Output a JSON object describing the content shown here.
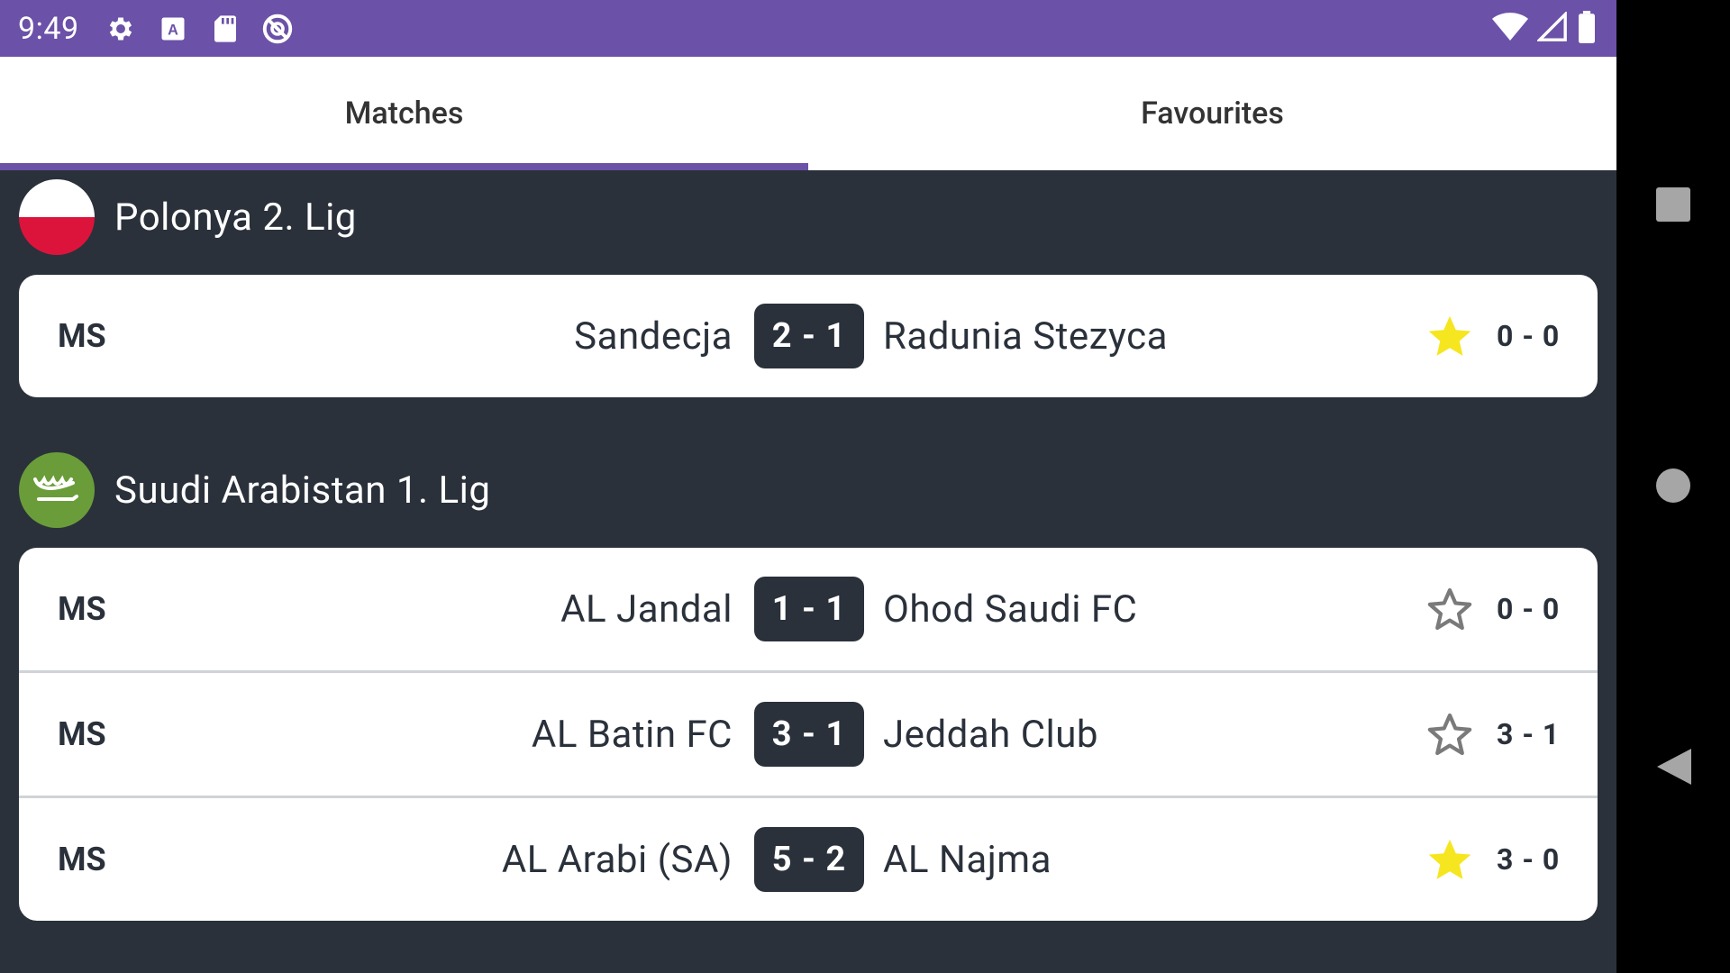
{
  "status_bar": {
    "time": "9:49",
    "icons": [
      "settings-icon",
      "font-a-icon",
      "sd-card-icon",
      "no-sync-icon"
    ],
    "right_icons": [
      "wifi-icon",
      "signal-icon",
      "battery-icon"
    ]
  },
  "tabs": [
    {
      "label": "Matches",
      "active": true
    },
    {
      "label": "Favourites",
      "active": false
    }
  ],
  "leagues": [
    {
      "name": "Polonya 2. Lig",
      "flag": "poland-flag",
      "matches": [
        {
          "status": "MS",
          "home": "Sandecja",
          "score": "2 - 1",
          "away": "Radunia Stezyca",
          "favourite": true,
          "half_time": "0 - 0"
        }
      ]
    },
    {
      "name": "Suudi Arabistan 1. Lig",
      "flag": "saudi-arabia-flag",
      "matches": [
        {
          "status": "MS",
          "home": "AL Jandal",
          "score": "1 - 1",
          "away": "Ohod Saudi FC",
          "favourite": false,
          "half_time": "0 - 0"
        },
        {
          "status": "MS",
          "home": "AL Batin FC",
          "score": "3 - 1",
          "away": "Jeddah Club",
          "favourite": false,
          "half_time": "3 - 1"
        },
        {
          "status": "MS",
          "home": "AL Arabi (SA)",
          "score": "5 - 2",
          "away": "AL Najma",
          "favourite": true,
          "half_time": "3 - 0"
        }
      ]
    }
  ],
  "colors": {
    "accent": "#6b51a8",
    "background": "#2a313b",
    "star_filled": "#f5e61f",
    "star_empty": "#7a7a7a"
  }
}
